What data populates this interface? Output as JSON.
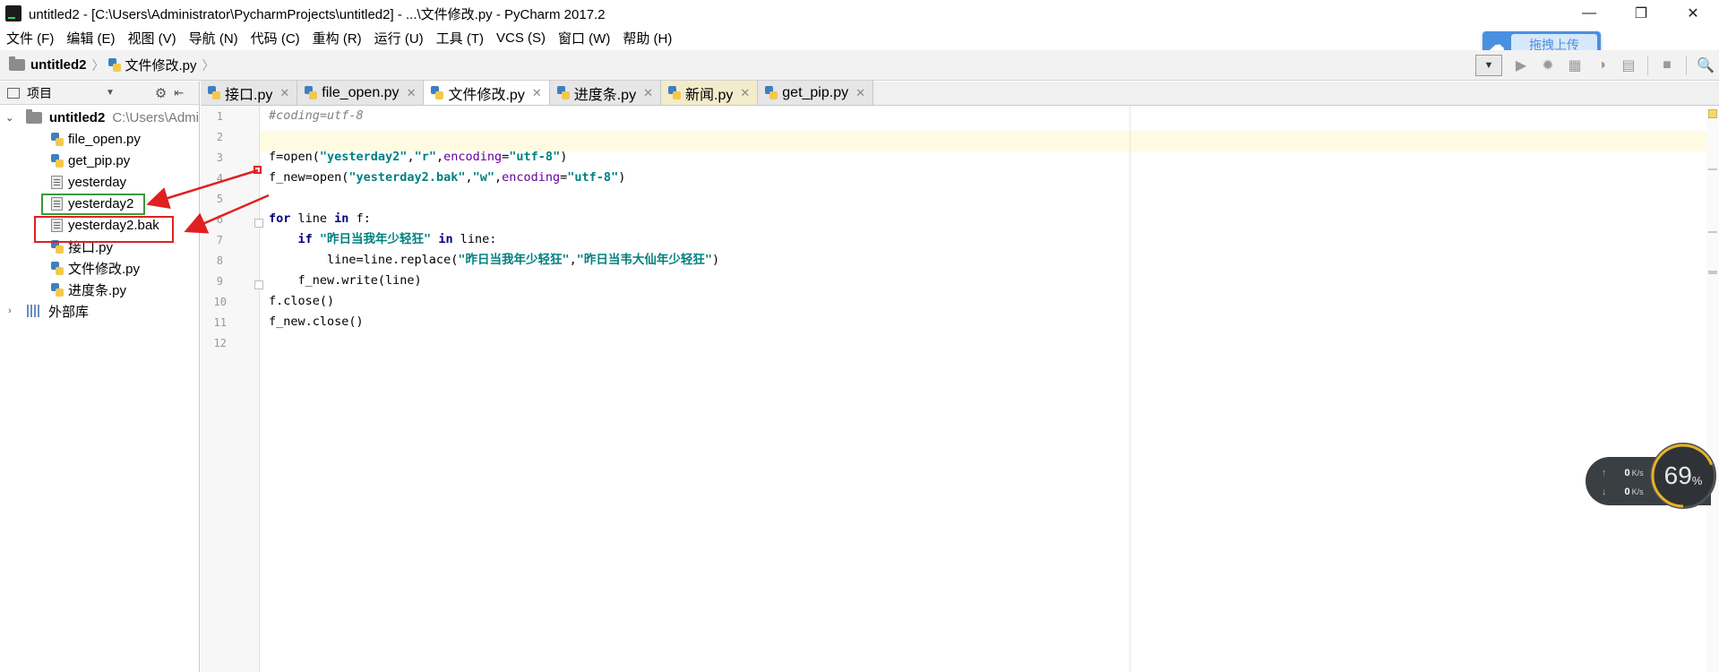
{
  "window": {
    "title": "untitled2 - [C:\\Users\\Administrator\\PycharmProjects\\untitled2] - ...\\文件修改.py - PyCharm 2017.2",
    "minimize": "—",
    "maximize": "❐",
    "close": "✕"
  },
  "menu": {
    "items": [
      "文件 (F)",
      "编辑 (E)",
      "视图 (V)",
      "导航 (N)",
      "代码 (C)",
      "重构 (R)",
      "运行 (U)",
      "工具 (T)",
      "VCS (S)",
      "窗口 (W)",
      "帮助 (H)"
    ]
  },
  "nav": {
    "project": "untitled2",
    "file": "文件修改.py"
  },
  "upload": {
    "label": "拖拽上传"
  },
  "project_panel": {
    "title": "项目",
    "root_name": "untitled2",
    "root_path": "C:\\Users\\Admi",
    "files": [
      "file_open.py",
      "get_pip.py",
      "yesterday",
      "yesterday2",
      "yesterday2.bak",
      "接口.py",
      "文件修改.py",
      "进度条.py"
    ],
    "external": "外部库"
  },
  "tabs": [
    "接口.py",
    "file_open.py",
    "文件修改.py",
    "进度条.py",
    "新闻.py",
    "get_pip.py"
  ],
  "active_tab": "文件修改.py",
  "editor": {
    "line_numbers": [
      "1",
      "2",
      "3",
      "4",
      "5",
      "6",
      "7",
      "8",
      "9",
      "10",
      "11",
      "12"
    ],
    "lines": [
      "#coding=utf-8",
      "",
      "f=open(\"yesterday2\",\"r\",encoding=\"utf-8\")",
      "f_new=open(\"yesterday2.bak\",\"w\",encoding=\"utf-8\")",
      "",
      "for line in f:",
      "    if \"昨日当我年少轻狂\" in line:",
      "        line=line.replace(\"昨日当我年少轻狂\",\"昨日当韦大仙年少轻狂\")",
      "    f_new.write(line)",
      "f.close()",
      "f_new.close()",
      ""
    ]
  },
  "net_widget": {
    "up_speed": "0",
    "down_speed": "0",
    "unit": "K/s",
    "cpu_value": "69",
    "cpu_unit": "%",
    "cpu_fraction": 0.69
  },
  "colors": {
    "keyword": "#000080",
    "string": "#008080",
    "comment": "#808080",
    "highlight_green": "#3a9a3a",
    "highlight_red": "#e02020"
  }
}
